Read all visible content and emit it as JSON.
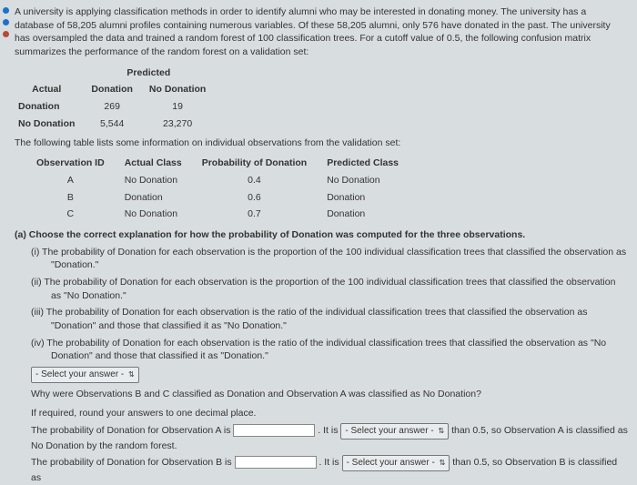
{
  "intro": "A university is applying classification methods in order to identify alumni who may be interested in donating money. The university has a database of 58,205 alumni profiles containing numerous variables. Of these 58,205 alumni, only 576 have donated in the past. The university has oversampled the data and trained a random forest of 100 classification trees. For a cutoff value of 0.5, the following confusion matrix summarizes the performance of the random forest on a validation set:",
  "conf": {
    "predicted": "Predicted",
    "actual": "Actual",
    "c1": "Donation",
    "c2": "No Donation",
    "r1": "Donation",
    "r2": "No Donation",
    "v11": "269",
    "v12": "19",
    "v21": "5,544",
    "v22": "23,270"
  },
  "obs_intro": "The following table lists some information on individual observations from the validation set:",
  "obs": {
    "h1": "Observation ID",
    "h2": "Actual Class",
    "h3": "Probability of Donation",
    "h4": "Predicted Class",
    "rows": [
      {
        "id": "A",
        "actual": "No Donation",
        "prob": "0.4",
        "pred": "No Donation"
      },
      {
        "id": "B",
        "actual": "Donation",
        "prob": "0.6",
        "pred": "Donation"
      },
      {
        "id": "C",
        "actual": "No Donation",
        "prob": "0.7",
        "pred": "Donation"
      }
    ]
  },
  "qa": "(a) Choose the correct explanation for how the probability of Donation was computed for the three observations.",
  "choices": {
    "i": "(i)  The probability of Donation for each observation is the proportion of the 100 individual classification trees that classified the observation as \"Donation.\"",
    "ii": "(ii) The probability of Donation for each observation is the proportion of the 100 individual classification trees that classified the observation as \"No Donation.\"",
    "iii": "(iii) The probability of Donation for each observation is the ratio of the individual classification trees that classified the observation as \"Donation\" and those that classified it as \"No Donation.\"",
    "iv": "(iv) The probability of Donation for each observation is the ratio of the individual classification trees that classified the observation as \"No Donation\" and those that classified it as \"Donation.\""
  },
  "select_label": "- Select your answer -",
  "why_q": "Why were Observations B and C classified as Donation and Observation A was classified as No Donation?",
  "round": "If required, round your answers to one decimal place.",
  "lineA_pre": "The probability of Donation for Observation A is ",
  "lineA_mid": ". It is ",
  "lineA_post": " than 0.5, so Observation A is classified as No Donation by the random forest.",
  "lineB_pre": "The probability of Donation for Observation B is ",
  "lineB_mid": ". It is ",
  "lineB_post": " than 0.5, so Observation B is classified as"
}
